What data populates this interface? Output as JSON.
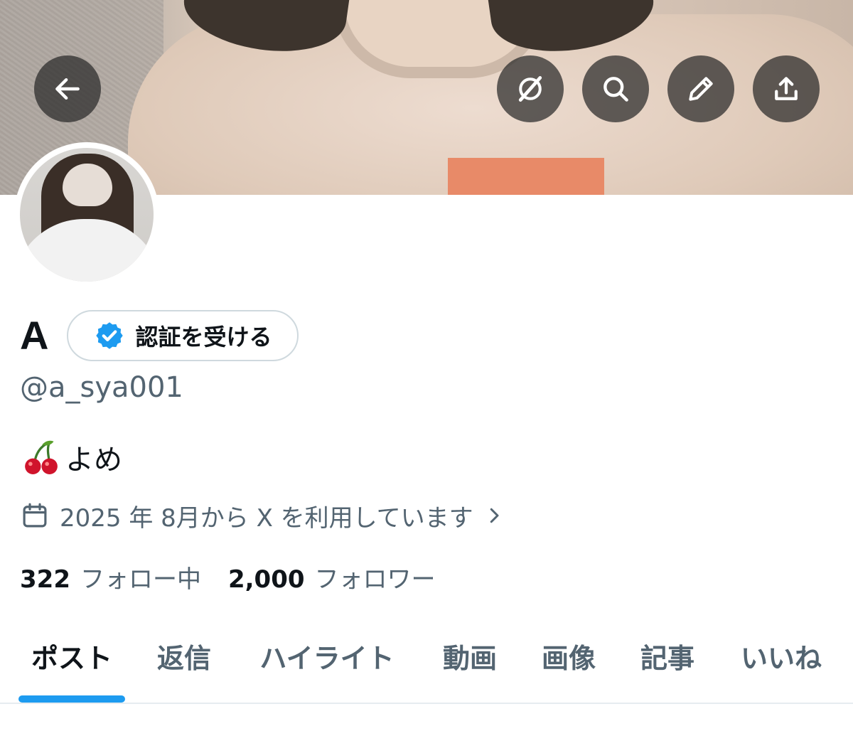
{
  "header": {
    "back_icon": "arrow-left-icon",
    "actions": [
      {
        "name": "grok-icon"
      },
      {
        "name": "search-icon"
      },
      {
        "name": "pencil-icon"
      },
      {
        "name": "share-icon"
      }
    ],
    "overlay_color": "#2a2a2a"
  },
  "profile": {
    "display_name": "A",
    "verify_button": {
      "label": "認証を受ける",
      "icon": "verified-badge-icon",
      "color": "#1d9bf0"
    },
    "handle": "@a_sya001",
    "bio": {
      "emoji": "cherries-emoji",
      "text": "よめ"
    },
    "joined": {
      "icon": "calendar-icon",
      "text": "2025 年 8月から X を利用しています"
    },
    "stats": {
      "following": {
        "count": "322",
        "label": "フォロー中"
      },
      "followers": {
        "count": "2,000",
        "label": "フォロワー"
      }
    }
  },
  "tabs": [
    {
      "label": "ポスト",
      "active": true
    },
    {
      "label": "返信"
    },
    {
      "label": "ハイライト"
    },
    {
      "label": "動画"
    },
    {
      "label": "画像"
    },
    {
      "label": "記事"
    },
    {
      "label": "いいね"
    }
  ],
  "colors": {
    "accent": "#1d9bf0",
    "secondary_text": "#536471",
    "primary_text": "#0f1419",
    "border": "#cfd9de"
  }
}
